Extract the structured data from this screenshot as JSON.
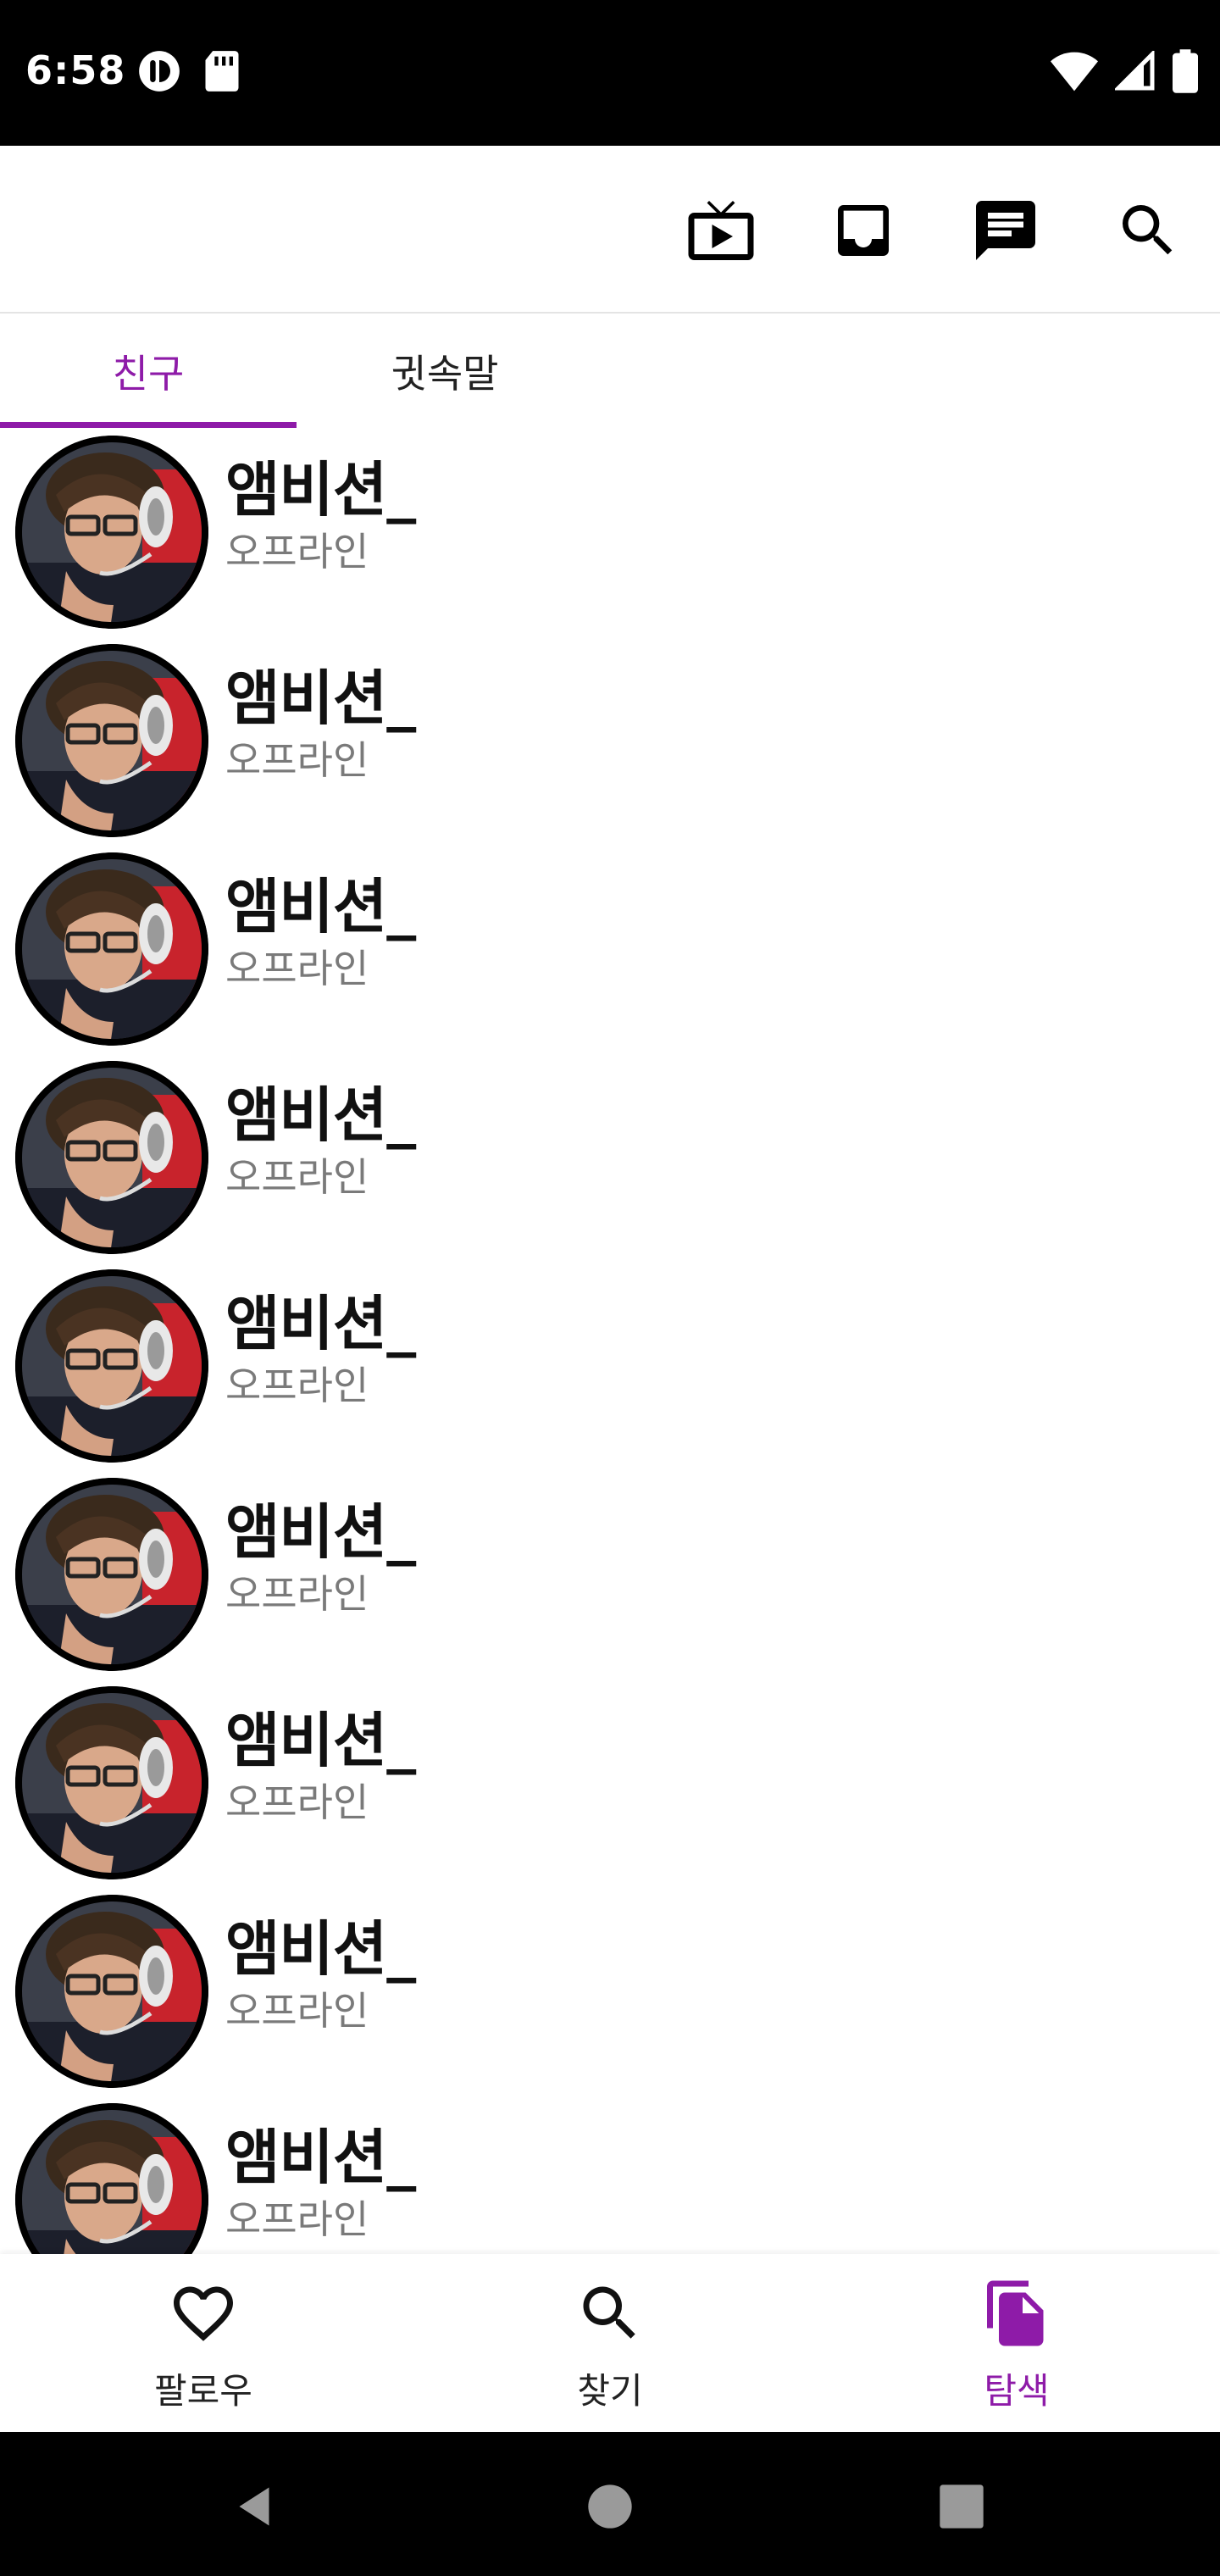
{
  "status_bar": {
    "time": "6:58",
    "left_icons": [
      "notification-icon",
      "sd-card-icon"
    ],
    "right_icons": [
      "wifi-icon",
      "signal-icon",
      "battery-icon"
    ]
  },
  "toolbar": {
    "icons": [
      "tv-play-icon",
      "inbox-icon",
      "chat-icon",
      "search-icon"
    ]
  },
  "tabs": [
    {
      "label": "친구",
      "active": true
    },
    {
      "label": "귓속말",
      "active": false
    }
  ],
  "friends": [
    {
      "name": "앰비션_",
      "status": "오프라인"
    },
    {
      "name": "앰비션_",
      "status": "오프라인"
    },
    {
      "name": "앰비션_",
      "status": "오프라인"
    },
    {
      "name": "앰비션_",
      "status": "오프라인"
    },
    {
      "name": "앰비션_",
      "status": "오프라인"
    },
    {
      "name": "앰비션_",
      "status": "오프라인"
    },
    {
      "name": "앰비션_",
      "status": "오프라인"
    },
    {
      "name": "앰비션_",
      "status": "오프라인"
    },
    {
      "name": "앰비션_",
      "status": "오프라인"
    }
  ],
  "bottom_nav": [
    {
      "label": "팔로우",
      "icon": "heart-outline-icon",
      "active": false
    },
    {
      "label": "찾기",
      "icon": "search-icon",
      "active": false
    },
    {
      "label": "탐색",
      "icon": "file-copy-icon",
      "active": true
    }
  ],
  "colors": {
    "accent": "#8e1ba8",
    "secondary_text": "#7a7a7a"
  },
  "system_nav": [
    "back-icon",
    "home-icon",
    "recents-icon"
  ]
}
